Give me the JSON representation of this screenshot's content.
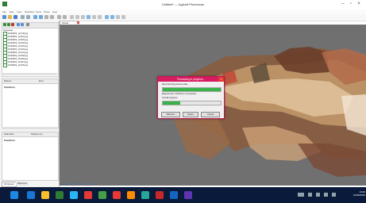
{
  "window": {
    "title": "Untitled* — Agisoft Photoscan"
  },
  "menu": [
    "File",
    "Edit",
    "View",
    "Workflow",
    "Tools",
    "Photo",
    "Help"
  ],
  "workspace": {
    "title": "Cameras",
    "cameras": [
      "20150806_112748.jpg",
      "20150806_113001.jpg",
      "20150806_113025.jpg",
      "20150806_113048.jpg",
      "20150806_113105.jpg",
      "20150806_113129.jpg",
      "20150806_113143.jpg",
      "20150806_113158.jpg",
      "20150806_113209.jpg",
      "20150806_113219.jpg",
      "20150806_113235.jpg"
    ]
  },
  "markers_pane": {
    "col1": "Markers",
    "col2": "Error",
    "total": "Total Error"
  },
  "scale_pane": {
    "col1": "Scale Bars",
    "col2": "Distance (m)",
    "total": "Total Error"
  },
  "tabs": {
    "workspace": "Workspace",
    "reference": "Reference"
  },
  "viewport": {
    "tab_label": "Model",
    "status": "Perspective 30° | 12.3 m | 0.51 fps"
  },
  "dialog": {
    "title": "Processing in progress...",
    "line1": "Reconstructing texture atlas...",
    "progress1": 1.0,
    "line2": "Elapsed time: 00:00:00 | 4 processed",
    "line3": "Overall progress:",
    "progress2": 0.3,
    "buttons": {
      "minimize": "Minimize",
      "pause": "Pause",
      "cancel": "Cancel"
    }
  },
  "taskbar": {
    "time": "13:40",
    "date": "10/06/2015"
  },
  "colors": {
    "dialog_accent": "#d81b60",
    "progress": "#37b34a",
    "taskbar": "#0a1a3a"
  }
}
